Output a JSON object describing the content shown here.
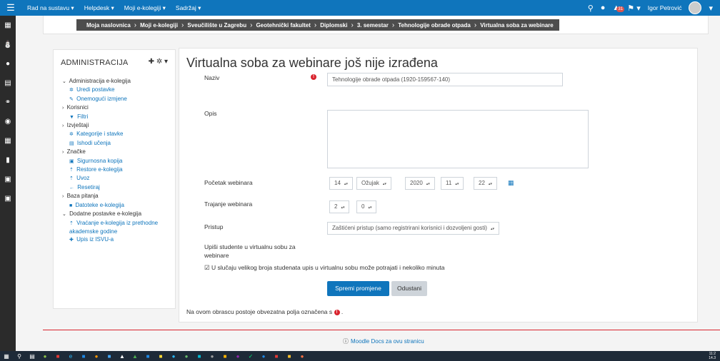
{
  "topbar": {
    "menu": [
      "Rad na sustavu ▾",
      "Helpdesk ▾",
      "Moji e-kolegiji ▾",
      "Sadržaj ▾"
    ],
    "notifications_count": "31",
    "user": "Igor Petrović"
  },
  "breadcrumb": [
    "Moja naslovnica",
    "Moji e-kolegiji",
    "Sveučilište u Zagrebu",
    "Geotehnički fakultet",
    "Diplomski",
    "3. semestar",
    "Tehnologije obrade otpada",
    "Virtualna soba za webinare"
  ],
  "admin": {
    "title": "ADMINISTRACIJA",
    "items": [
      {
        "label": "Administracija e-kolegija",
        "icon": "⌄",
        "level": 1
      },
      {
        "label": "Uredi postavke",
        "icon": "✲",
        "level": 2
      },
      {
        "label": "Onemogući izmjene",
        "icon": "✎",
        "level": 2
      },
      {
        "label": "Korisnici",
        "icon": "›",
        "level": 1
      },
      {
        "label": "Filtri",
        "icon": "▼",
        "level": 2
      },
      {
        "label": "Izvještaji",
        "icon": "›",
        "level": 1
      },
      {
        "label": "Kategorije i stavke",
        "icon": "✲",
        "level": 2
      },
      {
        "label": "Ishodi učenja",
        "icon": "▤",
        "level": 2
      },
      {
        "label": "Značke",
        "icon": "›",
        "level": 1
      },
      {
        "label": "Sigurnosna kopija",
        "icon": "▣",
        "level": 2
      },
      {
        "label": "Restore e-kolegija",
        "icon": "⇡",
        "level": 2
      },
      {
        "label": "Uvoz",
        "icon": "⇡",
        "level": 2
      },
      {
        "label": "Resetiraj",
        "icon": "←",
        "level": 2
      },
      {
        "label": "Baza pitanja",
        "icon": "›",
        "level": 1
      },
      {
        "label": "Datoteke e-kolegija",
        "icon": "■",
        "level": 2
      },
      {
        "label": "Dodatne postavke e-kolegija",
        "icon": "⌄",
        "level": 1
      },
      {
        "label": "Vraćanje e-kolegija iz prethodne akademske godine",
        "icon": "⇡",
        "level": 2
      },
      {
        "label": "Upis iz ISVU-a",
        "icon": "✚",
        "level": 2
      }
    ]
  },
  "form": {
    "title": "Virtualna soba za webinare još nije izrađena",
    "naziv_label": "Naziv",
    "naziv_value": "Tehnologije obrade otpada (1920-159567-140)",
    "opis_label": "Opis",
    "start_label": "Početak webinara",
    "start_day": "14",
    "start_month": "Ožujak",
    "start_year": "2020",
    "start_hour": "11",
    "start_minute": "22",
    "duration_label": "Trajanje webinara",
    "duration_h": "2",
    "duration_m": "0",
    "access_label": "Pristup",
    "access_value": "Zaštićeni pristup (samo registrirani korisnici i dozvoljeni gosti)",
    "enroll_label": "Upiši studente u virtualnu sobu za webinare",
    "enroll_note": "U slučaju velikog broja studenata upis u virtualnu sobu može potrajati i nekoliko minuta",
    "save_button": "Spremi promjene",
    "cancel_button": "Odustani",
    "required_note": "Na ovom obrascu postoje obvezatna polja označena s",
    "required_note_end": "."
  },
  "footer": {
    "docs": "Moodle Docs za ovu stranicu"
  },
  "tray": {
    "time": "11:2",
    "date": "14.3"
  }
}
